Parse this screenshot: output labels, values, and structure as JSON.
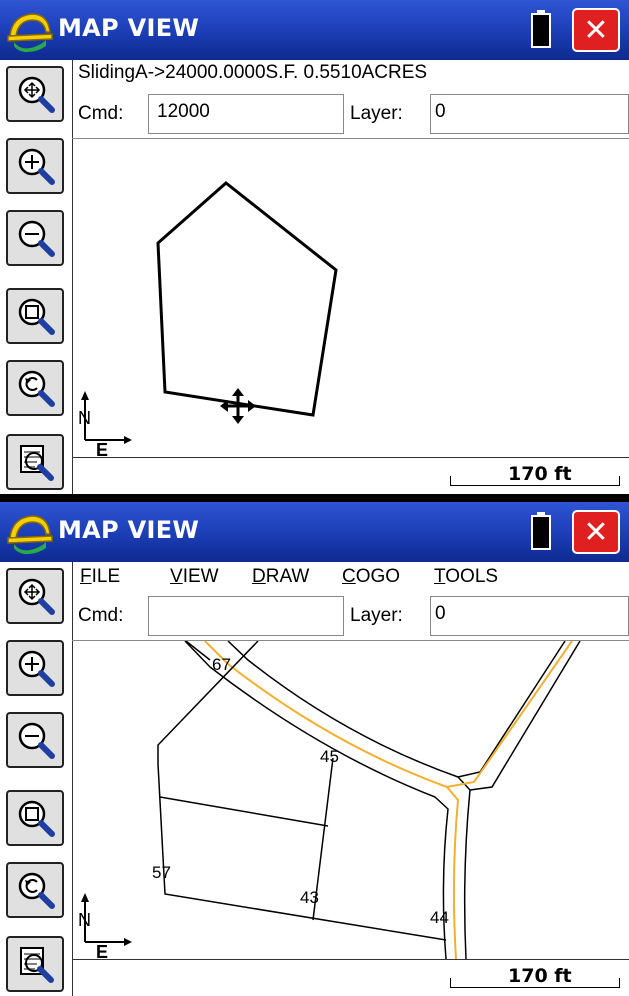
{
  "colors": {
    "titlebar": "#1d3fb8",
    "close_button": "#e02020",
    "road_line": "#f0b030"
  },
  "panel1": {
    "title": "MAP VIEW",
    "close_label": "✕",
    "info_text": "SlidingA->24000.0000S.F. 0.5510ACRES",
    "cmd_label": "Cmd:",
    "cmd_value": "12000",
    "layer_label": "Layer:",
    "layer_value": "0",
    "north_label": "N",
    "east_label": "E",
    "scale_label": "170 ft"
  },
  "panel2": {
    "title": "MAP VIEW",
    "close_label": "✕",
    "menus": {
      "file": "FILE",
      "view": "VIEW",
      "draw": "DRAW",
      "cogo": "COGO",
      "tools": "TOOLS"
    },
    "cmd_label": "Cmd:",
    "cmd_value": "",
    "layer_label": "Layer:",
    "layer_value": "0",
    "point_labels": {
      "p67": "67",
      "p45": "45",
      "p57": "57",
      "p43": "43",
      "p44": "44"
    },
    "north_label": "N",
    "east_label": "E",
    "scale_label": "170 ft"
  },
  "toolbar_icons": [
    "zoom-extents-icon",
    "zoom-in-icon",
    "zoom-out-icon",
    "zoom-window-icon",
    "zoom-previous-icon",
    "layer-view-icon"
  ]
}
